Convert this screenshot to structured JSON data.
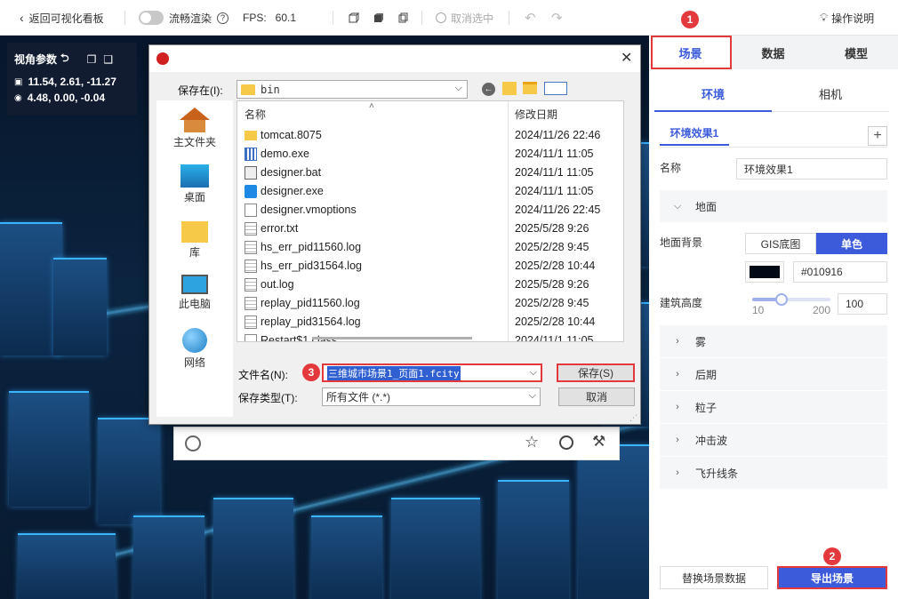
{
  "toolbar": {
    "back_label": "返回可视化看板",
    "smooth_label": "流畅渲染",
    "fps_label": "FPS:",
    "fps_value": "60.1",
    "deselect_label": "取消选中",
    "help_label": "操作说明"
  },
  "view_params": {
    "title": "视角参数",
    "camera_position": "11.54, 2.61, -11.27",
    "target_position": "4.48, 0.00, -0.04"
  },
  "right_panel": {
    "tabs": [
      "场景",
      "数据",
      "模型"
    ],
    "subtabs": [
      "环境",
      "相机"
    ],
    "effect_tab": "环境效果1",
    "name_label": "名称",
    "name_value": "环境效果1",
    "ground_section": "地面",
    "ground_bg_label": "地面背景",
    "ground_options": [
      "GIS底图",
      "单色"
    ],
    "color_hex": "#010916",
    "building_height_label": "建筑高度",
    "slider": {
      "min": "10",
      "max": "200",
      "value": "100",
      "fraction": 0.37
    },
    "sections": [
      "雾",
      "后期",
      "粒子",
      "冲击波",
      "飞升线条"
    ],
    "replace_button": "替换场景数据",
    "export_button": "导出场景"
  },
  "badges": [
    "1",
    "2",
    "3"
  ],
  "dialog": {
    "save_in_label": "保存在(I):",
    "folder": "bin",
    "places": [
      "主文件夹",
      "桌面",
      "库",
      "此电脑",
      "网络"
    ],
    "col_name": "名称",
    "col_date": "修改日期",
    "files": [
      {
        "name": "tomcat.8075",
        "date": "2024/11/26 22:46",
        "icon": "folder-icon"
      },
      {
        "name": "demo.exe",
        "date": "2024/11/1 11:05",
        "icon": "exe-icon"
      },
      {
        "name": "designer.bat",
        "date": "2024/11/1 11:05",
        "icon": "bat-icon"
      },
      {
        "name": "designer.exe",
        "date": "2024/11/1 11:05",
        "icon": "designer-exe-icon"
      },
      {
        "name": "designer.vmoptions",
        "date": "2024/11/26 22:45",
        "icon": "file-icon"
      },
      {
        "name": "error.txt",
        "date": "2025/5/28 9:26",
        "icon": "text-file-icon"
      },
      {
        "name": "hs_err_pid11560.log",
        "date": "2025/2/28 9:45",
        "icon": "text-file-icon"
      },
      {
        "name": "hs_err_pid31564.log",
        "date": "2025/2/28 10:44",
        "icon": "text-file-icon"
      },
      {
        "name": "out.log",
        "date": "2025/5/28 9:26",
        "icon": "text-file-icon"
      },
      {
        "name": "replay_pid11560.log",
        "date": "2025/2/28 9:45",
        "icon": "text-file-icon"
      },
      {
        "name": "replay_pid31564.log",
        "date": "2025/2/28 10:44",
        "icon": "text-file-icon"
      },
      {
        "name": "Restart$1.class",
        "date": "2024/11/1 11:05",
        "icon": "file-icon"
      }
    ],
    "filename_label": "文件名(N):",
    "filename_value": "三维城市场景1_页面1.fcity",
    "filetype_label": "保存类型(T):",
    "filetype_value": "所有文件 (*.*)",
    "save_button": "保存(S)",
    "cancel_button": "取消"
  }
}
